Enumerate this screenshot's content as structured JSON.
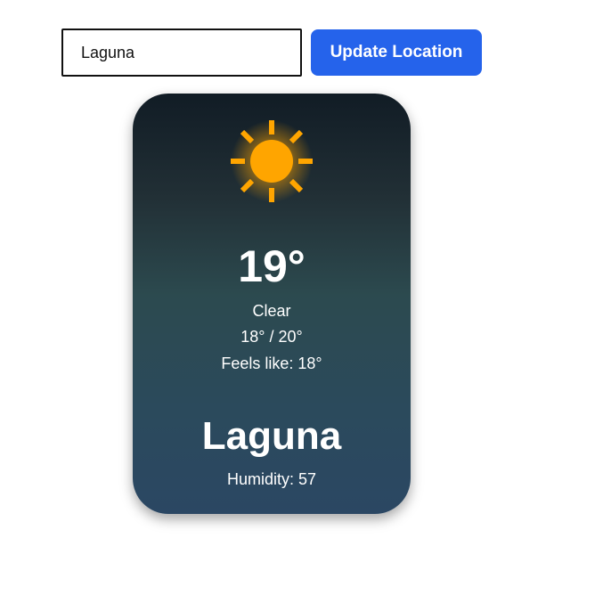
{
  "location_form": {
    "input_value": "Laguna",
    "button_label": "Update Location"
  },
  "weather": {
    "icon": "sun-icon",
    "icon_color": "#ffa500",
    "temperature": "19°",
    "condition": "Clear",
    "range": "18° / 20°",
    "feels_like_label": "Feels like:",
    "feels_like_value": "18°",
    "city": "Laguna",
    "humidity_label": "Humidity:",
    "humidity_value": "57"
  },
  "colors": {
    "button": "#2563eb",
    "card_top": "#111c25",
    "card_bottom": "#2b4763"
  }
}
